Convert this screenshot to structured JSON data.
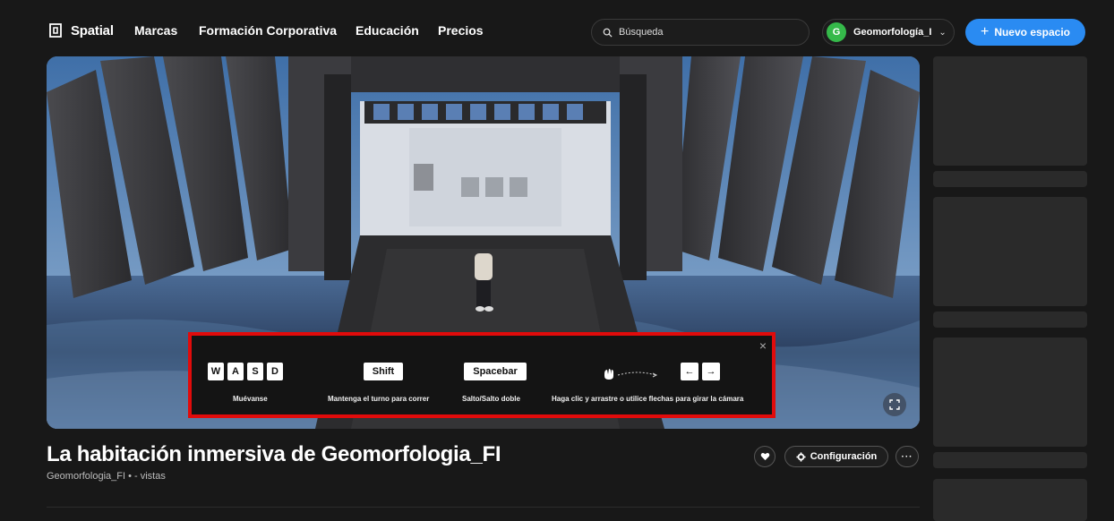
{
  "nav": {
    "brand": "Spatial",
    "links": [
      "Marcas",
      "Formación Corporativa",
      "Educación",
      "Precios"
    ],
    "search_placeholder": "Búsqueda",
    "user_initial": "G",
    "user_name": "Geomorfología_I",
    "new_space_label": "Nuevo espacio"
  },
  "controls": {
    "keys_move": [
      "W",
      "A",
      "S",
      "D"
    ],
    "key_shift": "Shift",
    "key_space": "Spacebar",
    "label_move": "Muévanse",
    "label_run": "Mantenga el turno para correr",
    "label_jump": "Salto/Salto doble",
    "label_camera": "Haga clic y arrastre o utilice flechas para girar la cámara",
    "arrow_left": "←",
    "arrow_right": "→",
    "close": "×"
  },
  "space": {
    "title": "La habitación inmersiva de Geomorfologia_FI",
    "subline": "Geomorfologia_FI • - vistas",
    "config_label": "Configuración",
    "more_label": "···"
  },
  "colors": {
    "accent": "#2a8bf2",
    "highlight_border": "#e10b0b",
    "avatar": "#35b94a"
  }
}
